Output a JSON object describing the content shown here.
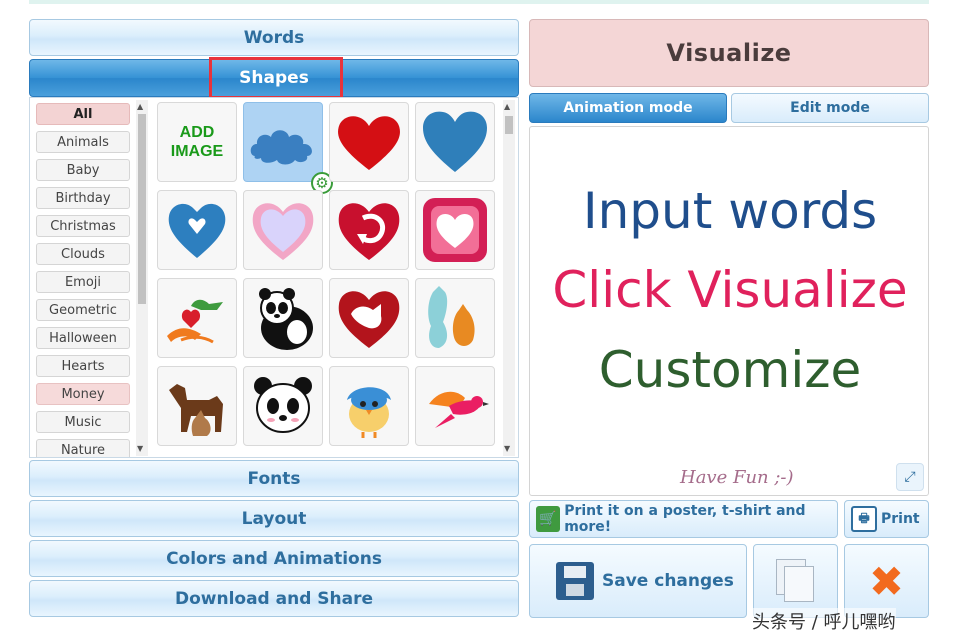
{
  "accordion": {
    "words": "Words",
    "shapes": "Shapes",
    "fonts": "Fonts",
    "layout": "Layout",
    "colors": "Colors and Animations",
    "download": "Download and Share"
  },
  "categories": [
    "All",
    "Animals",
    "Baby",
    "Birthday",
    "Christmas",
    "Clouds",
    "Emoji",
    "Geometric",
    "Halloween",
    "Hearts",
    "Money",
    "Music",
    "Nature"
  ],
  "selected_category": "All",
  "shapes_grid": {
    "add_image_line1": "ADD",
    "add_image_line2": "IMAGE",
    "tiles": [
      "cloud-shape",
      "red-heart-shape",
      "blue-heart-shape",
      "blue-heart-hole-shape",
      "lavender-heart-shape",
      "heart-arrow-shape",
      "pink-heart-button-shape",
      "heart-hands-shape",
      "panda-shape",
      "heart-cat-shape",
      "cat-dog-shape",
      "dog-cat-silhouette-shape",
      "panda-face-shape",
      "blue-bird-shape",
      "flying-bird-shape"
    ]
  },
  "visualize_label": "Visualize",
  "modes": {
    "animation": "Animation mode",
    "edit": "Edit mode"
  },
  "preview": {
    "line1": "Input words",
    "line2": "Click Visualize",
    "line3": "Customize",
    "footer": "Have Fun ;-)"
  },
  "actions": {
    "print_poster": "Print it on a poster, t-shirt and more!",
    "print": "Print",
    "save": "Save changes"
  },
  "watermark": "头条号 / 呼儿嘿哟",
  "colors": {
    "accent_blue": "#2b86cc",
    "visualize_bg": "#f4d6d6",
    "line1": "#1f4e8c",
    "line2": "#e0215c",
    "line3": "#2e5e2e",
    "highlight": "#e8333b"
  }
}
